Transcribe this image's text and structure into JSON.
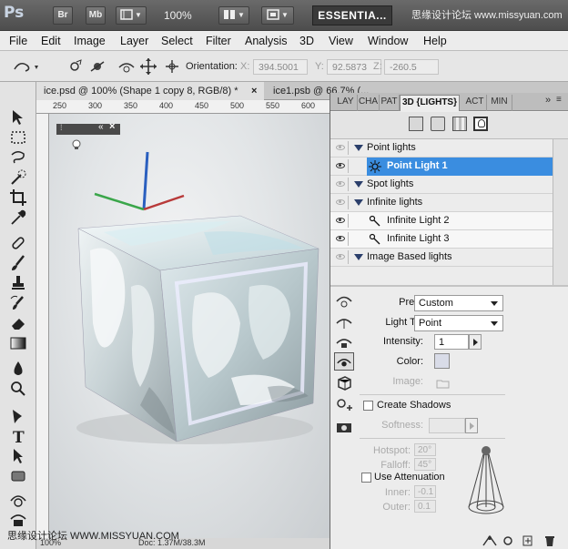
{
  "app": {
    "logo": "Ps",
    "bridge_label": "Br",
    "minibridge_label": "Mb",
    "zoom": "100%",
    "workspace": "ESSENTIA...",
    "watermark_top": "思缘设计论坛 www.missyuan.com"
  },
  "menu": [
    "File",
    "Edit",
    "Image",
    "Layer",
    "Select",
    "Filter",
    "Analysis",
    "3D",
    "View",
    "Window",
    "Help"
  ],
  "options": {
    "orientation_label": "Orientation:",
    "x_label": "X:",
    "x_value": "394.5001",
    "y_label": "Y:",
    "y_value": "92.5873",
    "z_label": "Z:",
    "z_value": "-260.5"
  },
  "tabs": {
    "doc1": "ice.psd @ 100% (Shape 1 copy 8, RGB/8) *",
    "doc2": "ice1.psb @ 66.7% (..."
  },
  "ruler": [
    "250",
    "300",
    "350",
    "400",
    "450",
    "500",
    "550",
    "600"
  ],
  "status": {
    "zoom": "100%",
    "doc_size": "Doc: 1.37M/38.3M"
  },
  "panel": {
    "tabs": [
      "LAY",
      "CHA",
      "PAT",
      "3D {LIGHTS}",
      "ACT",
      "MIN"
    ],
    "lights": {
      "group_point": "Point lights",
      "point_light_1": "Point Light 1",
      "group_spot": "Spot lights",
      "group_infinite": "Infinite lights",
      "infinite_light_2": "Infinite Light 2",
      "infinite_light_3": "Infinite Light 3",
      "group_ibl": "Image Based lights"
    },
    "props": {
      "preset_label": "Preset:",
      "preset_value": "Custom",
      "light_type_label": "Light Type:",
      "light_type_value": "Point",
      "intensity_label": "Intensity:",
      "intensity_value": "1",
      "color_label": "Color:",
      "image_label": "Image:",
      "create_shadows_label": "Create Shadows",
      "softness_label": "Softness:",
      "hotspot_label": "Hotspot:",
      "hotspot_value": "20°",
      "falloff_label": "Falloff:",
      "falloff_value": "45°",
      "use_attenuation_label": "Use Attenuation",
      "inner_label": "Inner:",
      "inner_value": "-0.1",
      "outer_label": "Outer:",
      "outer_value": "0.1"
    }
  },
  "watermark_bottom": "思缘设计论坛 WWW.MISSYUAN.COM",
  "colors": {
    "selection": "#3a8de0",
    "group_triangle": "#2b3f6b",
    "light_color_swatch": "#d9dce8"
  }
}
